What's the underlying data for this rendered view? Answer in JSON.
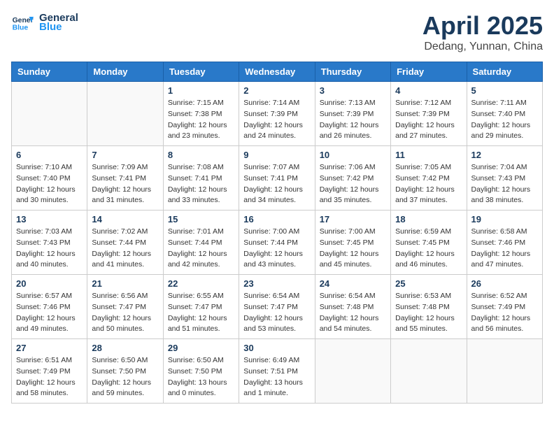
{
  "header": {
    "logo_line1": "General",
    "logo_line2": "Blue",
    "month": "April 2025",
    "location": "Dedang, Yunnan, China"
  },
  "weekdays": [
    "Sunday",
    "Monday",
    "Tuesday",
    "Wednesday",
    "Thursday",
    "Friday",
    "Saturday"
  ],
  "weeks": [
    [
      {
        "day": "",
        "info": ""
      },
      {
        "day": "",
        "info": ""
      },
      {
        "day": "1",
        "info": "Sunrise: 7:15 AM\nSunset: 7:38 PM\nDaylight: 12 hours\nand 23 minutes."
      },
      {
        "day": "2",
        "info": "Sunrise: 7:14 AM\nSunset: 7:39 PM\nDaylight: 12 hours\nand 24 minutes."
      },
      {
        "day": "3",
        "info": "Sunrise: 7:13 AM\nSunset: 7:39 PM\nDaylight: 12 hours\nand 26 minutes."
      },
      {
        "day": "4",
        "info": "Sunrise: 7:12 AM\nSunset: 7:39 PM\nDaylight: 12 hours\nand 27 minutes."
      },
      {
        "day": "5",
        "info": "Sunrise: 7:11 AM\nSunset: 7:40 PM\nDaylight: 12 hours\nand 29 minutes."
      }
    ],
    [
      {
        "day": "6",
        "info": "Sunrise: 7:10 AM\nSunset: 7:40 PM\nDaylight: 12 hours\nand 30 minutes."
      },
      {
        "day": "7",
        "info": "Sunrise: 7:09 AM\nSunset: 7:41 PM\nDaylight: 12 hours\nand 31 minutes."
      },
      {
        "day": "8",
        "info": "Sunrise: 7:08 AM\nSunset: 7:41 PM\nDaylight: 12 hours\nand 33 minutes."
      },
      {
        "day": "9",
        "info": "Sunrise: 7:07 AM\nSunset: 7:41 PM\nDaylight: 12 hours\nand 34 minutes."
      },
      {
        "day": "10",
        "info": "Sunrise: 7:06 AM\nSunset: 7:42 PM\nDaylight: 12 hours\nand 35 minutes."
      },
      {
        "day": "11",
        "info": "Sunrise: 7:05 AM\nSunset: 7:42 PM\nDaylight: 12 hours\nand 37 minutes."
      },
      {
        "day": "12",
        "info": "Sunrise: 7:04 AM\nSunset: 7:43 PM\nDaylight: 12 hours\nand 38 minutes."
      }
    ],
    [
      {
        "day": "13",
        "info": "Sunrise: 7:03 AM\nSunset: 7:43 PM\nDaylight: 12 hours\nand 40 minutes."
      },
      {
        "day": "14",
        "info": "Sunrise: 7:02 AM\nSunset: 7:44 PM\nDaylight: 12 hours\nand 41 minutes."
      },
      {
        "day": "15",
        "info": "Sunrise: 7:01 AM\nSunset: 7:44 PM\nDaylight: 12 hours\nand 42 minutes."
      },
      {
        "day": "16",
        "info": "Sunrise: 7:00 AM\nSunset: 7:44 PM\nDaylight: 12 hours\nand 43 minutes."
      },
      {
        "day": "17",
        "info": "Sunrise: 7:00 AM\nSunset: 7:45 PM\nDaylight: 12 hours\nand 45 minutes."
      },
      {
        "day": "18",
        "info": "Sunrise: 6:59 AM\nSunset: 7:45 PM\nDaylight: 12 hours\nand 46 minutes."
      },
      {
        "day": "19",
        "info": "Sunrise: 6:58 AM\nSunset: 7:46 PM\nDaylight: 12 hours\nand 47 minutes."
      }
    ],
    [
      {
        "day": "20",
        "info": "Sunrise: 6:57 AM\nSunset: 7:46 PM\nDaylight: 12 hours\nand 49 minutes."
      },
      {
        "day": "21",
        "info": "Sunrise: 6:56 AM\nSunset: 7:47 PM\nDaylight: 12 hours\nand 50 minutes."
      },
      {
        "day": "22",
        "info": "Sunrise: 6:55 AM\nSunset: 7:47 PM\nDaylight: 12 hours\nand 51 minutes."
      },
      {
        "day": "23",
        "info": "Sunrise: 6:54 AM\nSunset: 7:47 PM\nDaylight: 12 hours\nand 53 minutes."
      },
      {
        "day": "24",
        "info": "Sunrise: 6:54 AM\nSunset: 7:48 PM\nDaylight: 12 hours\nand 54 minutes."
      },
      {
        "day": "25",
        "info": "Sunrise: 6:53 AM\nSunset: 7:48 PM\nDaylight: 12 hours\nand 55 minutes."
      },
      {
        "day": "26",
        "info": "Sunrise: 6:52 AM\nSunset: 7:49 PM\nDaylight: 12 hours\nand 56 minutes."
      }
    ],
    [
      {
        "day": "27",
        "info": "Sunrise: 6:51 AM\nSunset: 7:49 PM\nDaylight: 12 hours\nand 58 minutes."
      },
      {
        "day": "28",
        "info": "Sunrise: 6:50 AM\nSunset: 7:50 PM\nDaylight: 12 hours\nand 59 minutes."
      },
      {
        "day": "29",
        "info": "Sunrise: 6:50 AM\nSunset: 7:50 PM\nDaylight: 13 hours\nand 0 minutes."
      },
      {
        "day": "30",
        "info": "Sunrise: 6:49 AM\nSunset: 7:51 PM\nDaylight: 13 hours\nand 1 minute."
      },
      {
        "day": "",
        "info": ""
      },
      {
        "day": "",
        "info": ""
      },
      {
        "day": "",
        "info": ""
      }
    ]
  ]
}
